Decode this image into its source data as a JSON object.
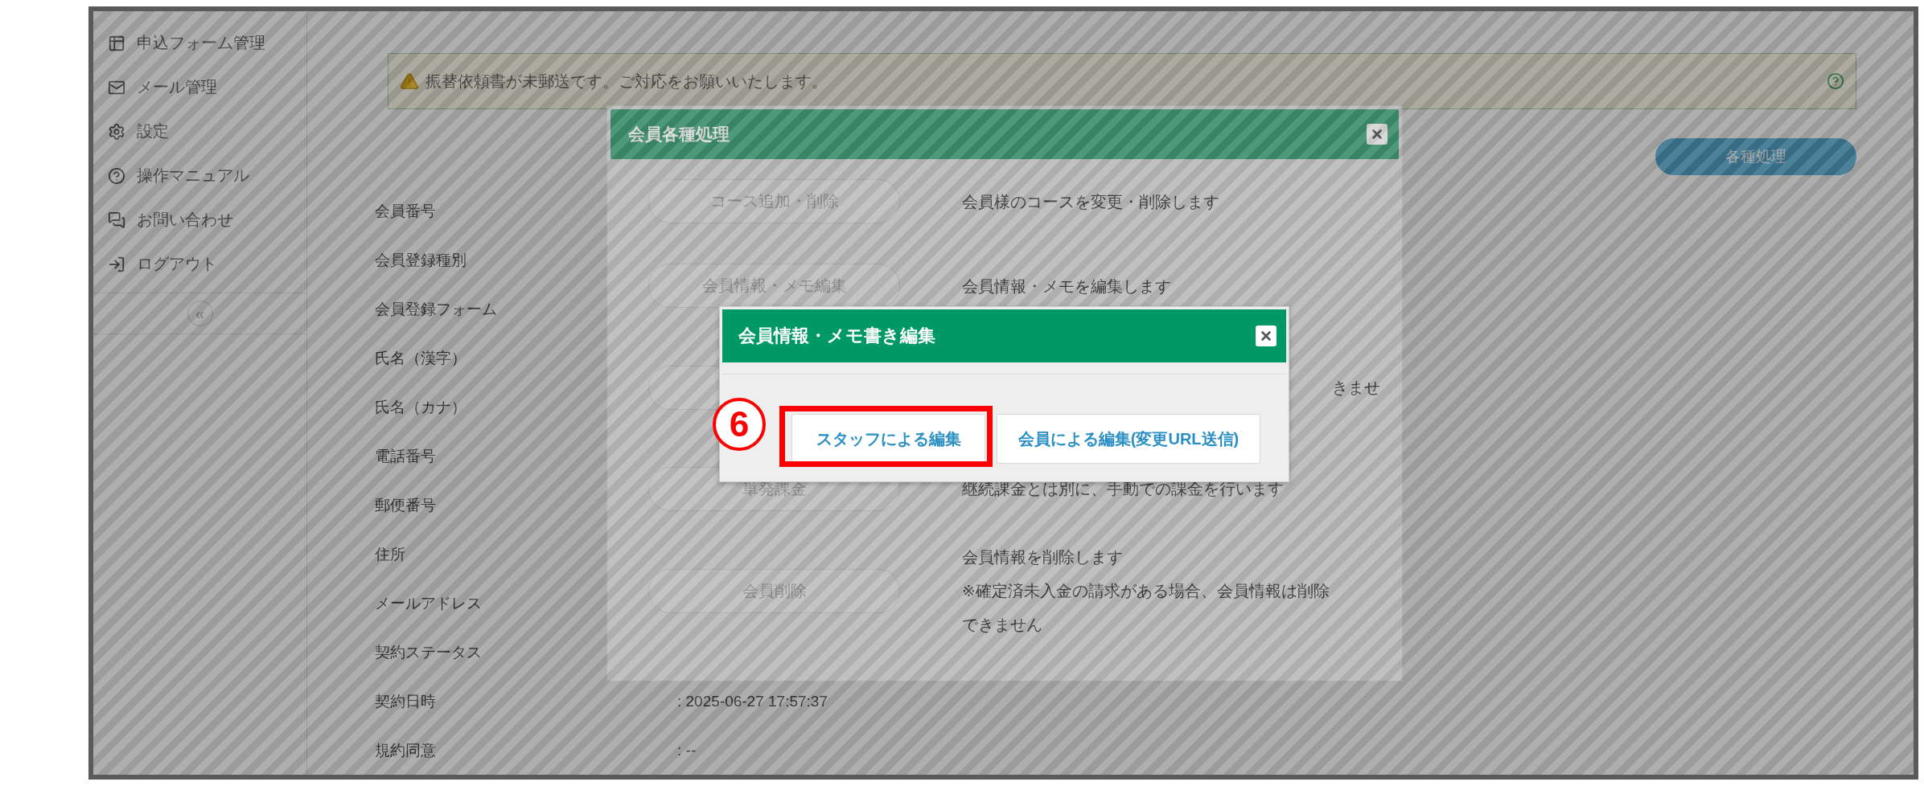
{
  "sidebar": {
    "items": [
      {
        "label": "申込フォーム管理"
      },
      {
        "label": "メール管理"
      },
      {
        "label": "設定"
      },
      {
        "label": "操作マニュアル"
      },
      {
        "label": "お問い合わせ"
      },
      {
        "label": "ログアウト"
      }
    ],
    "collapse": "«"
  },
  "alert": {
    "message": "振替依頼書が未郵送です。ご対応をお願いいたします。"
  },
  "actions_button": "各種処理",
  "fields": [
    {
      "label": "会員番号"
    },
    {
      "label": "会員登録種別"
    },
    {
      "label": "会員登録フォーム"
    },
    {
      "label": "氏名（漢字）"
    },
    {
      "label": "氏名（カナ）"
    },
    {
      "label": "電話番号"
    },
    {
      "label": "郵便番号"
    },
    {
      "label": "住所"
    },
    {
      "label": "メールアドレス"
    },
    {
      "label": "契約ステータス"
    },
    {
      "label": "契約日時",
      "value": ": 2025-06-27 17:57:37"
    },
    {
      "label": "規約同意",
      "value": ": --"
    }
  ],
  "modal": {
    "title": "会員各種処理",
    "rows": [
      {
        "kind": "action",
        "button": "コース追加・削除",
        "description": [
          "会員様のコースを変更・削除します"
        ]
      },
      {
        "kind": "action",
        "button": "会員情報・メモ編集",
        "description": [
          "会員情報・メモを編集します"
        ]
      },
      {
        "kind": "covered",
        "description": [
          "きませ"
        ]
      },
      {
        "kind": "action",
        "button": "単発課金",
        "description": [
          "継続課金とは別に、手動での課金を行います"
        ]
      },
      {
        "kind": "action",
        "button": "会員削除",
        "description": [
          "会員情報を削除します",
          "※確定済未入金の請求がある場合、会員情報は削除",
          "できません"
        ]
      }
    ]
  },
  "dialog": {
    "title": "会員情報・メモ書き編集",
    "step": "6",
    "buttons": [
      {
        "label": "スタッフによる編集",
        "highlighted": true
      },
      {
        "label": "会員による編集(変更URL送信)",
        "highlighted": false
      }
    ]
  }
}
